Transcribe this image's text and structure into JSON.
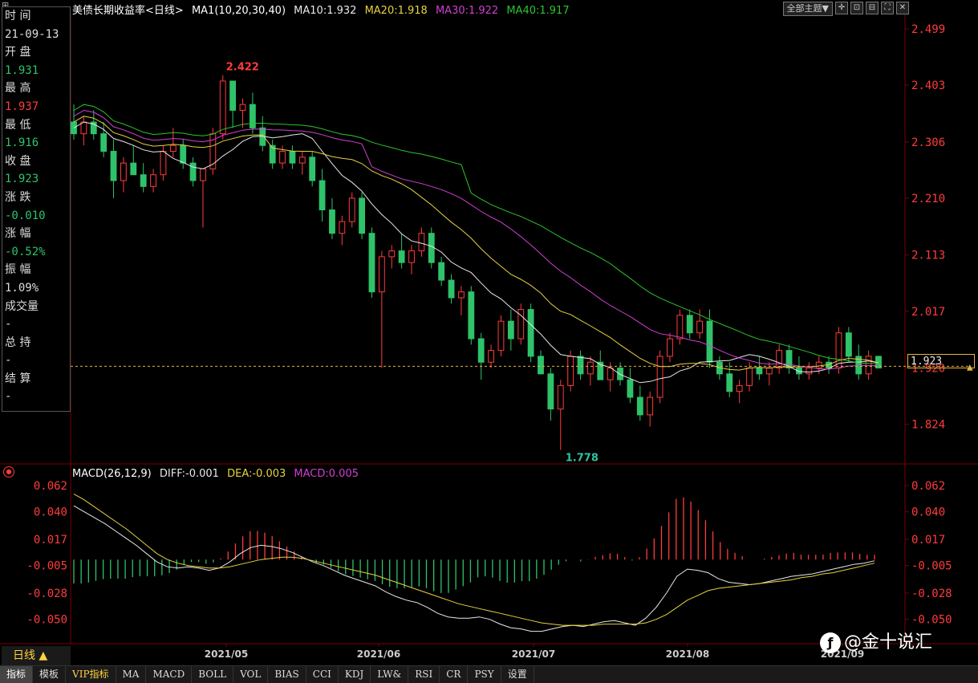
{
  "header": {
    "title": "美债长期收益率<日线>",
    "ma_label": "MA1(10,20,30,40)",
    "ma10": "MA10:1.932",
    "ma20": "MA20:1.918",
    "ma30": "MA30:1.922",
    "ma40": "MA40:1.917",
    "theme_btn": "全部主题▼"
  },
  "colors": {
    "up": "#ff3b3b",
    "down": "#2ec36a",
    "ma10": "#e8e8e8",
    "ma20": "#e7d23f",
    "ma30": "#d23fd2",
    "ma40": "#2ec32e",
    "diff": "#e8e8e8",
    "dea": "#e7d23f",
    "macd": "#d23fd2",
    "axis": "#ff3b3b",
    "grid": "#3a0000"
  },
  "info_panel": [
    {
      "label": "时 间",
      "value": "21-09-13",
      "color": "white"
    },
    {
      "label": "开 盘",
      "value": "1.931",
      "color": "green"
    },
    {
      "label": "最 高",
      "value": "1.937",
      "color": "red"
    },
    {
      "label": "最 低",
      "value": "1.916",
      "color": "green"
    },
    {
      "label": "收 盘",
      "value": "1.923",
      "color": "green"
    },
    {
      "label": "涨 跌",
      "value": "-0.010",
      "color": "green"
    },
    {
      "label": "涨 幅",
      "value": "-0.52%",
      "color": "green"
    },
    {
      "label": "振 幅",
      "value": "1.09%",
      "color": "white"
    },
    {
      "label": "成交量",
      "value": "-",
      "color": "white"
    },
    {
      "label": "总 持",
      "value": "-",
      "color": "white"
    },
    {
      "label": "结 算",
      "value": "-",
      "color": "white"
    }
  ],
  "current_price": "1.923",
  "macd_header": {
    "label": "MACD(26,12,9)",
    "diff": "DIFF:-0.001",
    "dea": "DEA:-0.003",
    "macd": "MACD:0.005"
  },
  "daily_btn": "日线 ▲",
  "bottom_tabs": [
    "指标",
    "模板",
    "VIP指标",
    "MA",
    "MACD",
    "BOLL",
    "VOL",
    "BIAS",
    "CCI",
    "KDJ",
    "LW&",
    "RSI",
    "CR",
    "PSY",
    "设置"
  ],
  "watermark": "@金十说汇",
  "chart_data": [
    {
      "type": "candlestick",
      "title": "美债长期收益率<日线>",
      "y_ticks": [
        2.499,
        2.403,
        2.306,
        2.21,
        2.113,
        2.017,
        1.92,
        1.824
      ],
      "ylim": [
        1.778,
        2.499
      ],
      "x_labels": [
        "2021/05",
        "2021/06",
        "2021/07",
        "2021/08",
        "2021/09"
      ],
      "annotations": {
        "high": "2.422",
        "low": "1.778"
      },
      "ohlc_sample": [
        [
          2.34,
          2.37,
          2.31,
          2.32
        ],
        [
          2.32,
          2.35,
          2.3,
          2.34
        ],
        [
          2.34,
          2.36,
          2.31,
          2.32
        ],
        [
          2.32,
          2.34,
          2.28,
          2.29
        ],
        [
          2.29,
          2.31,
          2.21,
          2.24
        ],
        [
          2.24,
          2.28,
          2.22,
          2.27
        ],
        [
          2.27,
          2.3,
          2.25,
          2.25
        ],
        [
          2.25,
          2.27,
          2.22,
          2.23
        ],
        [
          2.23,
          2.26,
          2.22,
          2.25
        ],
        [
          2.25,
          2.3,
          2.24,
          2.29
        ],
        [
          2.29,
          2.33,
          2.28,
          2.3
        ],
        [
          2.3,
          2.31,
          2.26,
          2.27
        ],
        [
          2.27,
          2.28,
          2.23,
          2.24
        ],
        [
          2.24,
          2.26,
          2.16,
          2.26
        ],
        [
          2.26,
          2.33,
          2.25,
          2.32
        ],
        [
          2.32,
          2.42,
          2.31,
          2.41
        ],
        [
          2.41,
          2.41,
          2.33,
          2.36
        ],
        [
          2.36,
          2.38,
          2.33,
          2.37
        ],
        [
          2.37,
          2.39,
          2.32,
          2.33
        ],
        [
          2.33,
          2.35,
          2.29,
          2.3
        ],
        [
          2.3,
          2.31,
          2.26,
          2.27
        ],
        [
          2.27,
          2.3,
          2.26,
          2.29
        ],
        [
          2.29,
          2.3,
          2.26,
          2.27
        ],
        [
          2.27,
          2.29,
          2.25,
          2.28
        ],
        [
          2.28,
          2.29,
          2.23,
          2.24
        ],
        [
          2.24,
          2.26,
          2.17,
          2.19
        ],
        [
          2.19,
          2.21,
          2.14,
          2.15
        ],
        [
          2.15,
          2.18,
          2.13,
          2.17
        ],
        [
          2.17,
          2.22,
          2.16,
          2.21
        ],
        [
          2.21,
          2.22,
          2.14,
          2.15
        ],
        [
          2.15,
          2.16,
          2.04,
          2.05
        ],
        [
          2.05,
          2.12,
          1.92,
          2.11
        ],
        [
          2.11,
          2.13,
          2.09,
          2.12
        ],
        [
          2.12,
          2.15,
          2.09,
          2.1
        ],
        [
          2.1,
          2.13,
          2.08,
          2.12
        ],
        [
          2.12,
          2.16,
          2.11,
          2.15
        ],
        [
          2.15,
          2.16,
          2.09,
          2.1
        ],
        [
          2.1,
          2.11,
          2.06,
          2.07
        ],
        [
          2.07,
          2.08,
          2.03,
          2.04
        ],
        [
          2.04,
          2.06,
          2.01,
          2.05
        ],
        [
          2.05,
          2.06,
          1.96,
          1.97
        ],
        [
          1.97,
          1.98,
          1.9,
          1.93
        ],
        [
          1.93,
          1.96,
          1.92,
          1.95
        ],
        [
          1.95,
          2.01,
          1.94,
          2.0
        ],
        [
          2.0,
          2.02,
          1.95,
          1.97
        ],
        [
          1.97,
          2.03,
          1.96,
          2.02
        ],
        [
          2.02,
          2.03,
          1.93,
          1.94
        ],
        [
          1.94,
          1.95,
          1.91,
          1.91
        ],
        [
          1.91,
          1.92,
          1.83,
          1.85
        ],
        [
          1.85,
          1.9,
          1.78,
          1.89
        ],
        [
          1.89,
          1.95,
          1.88,
          1.94
        ],
        [
          1.94,
          1.95,
          1.9,
          1.91
        ],
        [
          1.91,
          1.94,
          1.89,
          1.93
        ],
        [
          1.93,
          1.95,
          1.9,
          1.9
        ],
        [
          1.9,
          1.93,
          1.88,
          1.92
        ],
        [
          1.92,
          1.93,
          1.89,
          1.9
        ],
        [
          1.9,
          1.92,
          1.86,
          1.87
        ],
        [
          1.87,
          1.89,
          1.83,
          1.84
        ],
        [
          1.84,
          1.88,
          1.82,
          1.87
        ],
        [
          1.87,
          1.95,
          1.86,
          1.94
        ],
        [
          1.94,
          1.98,
          1.93,
          1.97
        ],
        [
          1.97,
          2.02,
          1.96,
          2.01
        ],
        [
          2.01,
          2.02,
          1.97,
          1.98
        ],
        [
          1.98,
          2.02,
          1.97,
          2.0
        ],
        [
          2.0,
          2.02,
          1.92,
          1.93
        ],
        [
          1.93,
          1.94,
          1.9,
          1.91
        ],
        [
          1.91,
          1.93,
          1.87,
          1.88
        ],
        [
          1.88,
          1.9,
          1.86,
          1.89
        ],
        [
          1.89,
          1.93,
          1.88,
          1.92
        ],
        [
          1.92,
          1.94,
          1.9,
          1.91
        ],
        [
          1.91,
          1.93,
          1.89,
          1.92
        ],
        [
          1.92,
          1.96,
          1.91,
          1.95
        ],
        [
          1.95,
          1.96,
          1.91,
          1.92
        ],
        [
          1.92,
          1.94,
          1.9,
          1.91
        ],
        [
          1.91,
          1.93,
          1.9,
          1.92
        ],
        [
          1.92,
          1.94,
          1.91,
          1.93
        ],
        [
          1.93,
          1.94,
          1.91,
          1.92
        ],
        [
          1.92,
          1.99,
          1.91,
          1.98
        ],
        [
          1.98,
          1.99,
          1.93,
          1.94
        ],
        [
          1.94,
          1.96,
          1.9,
          1.91
        ],
        [
          1.91,
          1.95,
          1.9,
          1.94
        ],
        [
          1.94,
          1.94,
          1.92,
          1.92
        ]
      ]
    },
    {
      "type": "macd",
      "title": "MACD(26,12,9)",
      "y_ticks": [
        0.062,
        0.04,
        0.017,
        -0.005,
        -0.028,
        -0.05
      ],
      "ylim": [
        -0.065,
        0.068
      ],
      "diff_sample": [
        0.045,
        0.04,
        0.035,
        0.03,
        0.024,
        0.018,
        0.012,
        0.005,
        -0.002,
        -0.006,
        -0.007,
        -0.006,
        -0.007,
        -0.009,
        -0.007,
        -0.002,
        0.005,
        0.01,
        0.012,
        0.011,
        0.009,
        0.006,
        0.002,
        -0.002,
        -0.005,
        -0.009,
        -0.013,
        -0.016,
        -0.019,
        -0.022,
        -0.027,
        -0.031,
        -0.034,
        -0.036,
        -0.04,
        -0.045,
        -0.048,
        -0.049,
        -0.049,
        -0.048,
        -0.05,
        -0.054,
        -0.057,
        -0.058,
        -0.06,
        -0.06,
        -0.058,
        -0.056,
        -0.055,
        -0.056,
        -0.054,
        -0.052,
        -0.051,
        -0.053,
        -0.055,
        -0.049,
        -0.04,
        -0.028,
        -0.014,
        -0.008,
        -0.009,
        -0.011,
        -0.016,
        -0.019,
        -0.02,
        -0.021,
        -0.02,
        -0.018,
        -0.016,
        -0.014,
        -0.013,
        -0.012,
        -0.01,
        -0.008,
        -0.006,
        -0.004,
        -0.003,
        -0.001
      ],
      "dea_sample": [
        0.055,
        0.05,
        0.044,
        0.038,
        0.032,
        0.026,
        0.019,
        0.012,
        0.005,
        0.0,
        -0.003,
        -0.005,
        -0.006,
        -0.007,
        -0.007,
        -0.006,
        -0.004,
        -0.002,
        0.0,
        0.001,
        0.002,
        0.002,
        0.001,
        -0.001,
        -0.003,
        -0.005,
        -0.007,
        -0.009,
        -0.011,
        -0.013,
        -0.016,
        -0.019,
        -0.022,
        -0.025,
        -0.028,
        -0.031,
        -0.034,
        -0.037,
        -0.039,
        -0.041,
        -0.043,
        -0.045,
        -0.047,
        -0.049,
        -0.051,
        -0.053,
        -0.054,
        -0.055,
        -0.055,
        -0.055,
        -0.055,
        -0.054,
        -0.054,
        -0.054,
        -0.054,
        -0.053,
        -0.05,
        -0.046,
        -0.04,
        -0.034,
        -0.03,
        -0.026,
        -0.024,
        -0.023,
        -0.022,
        -0.021,
        -0.02,
        -0.019,
        -0.018,
        -0.017,
        -0.015,
        -0.014,
        -0.012,
        -0.011,
        -0.009,
        -0.007,
        -0.005,
        -0.003
      ]
    }
  ]
}
